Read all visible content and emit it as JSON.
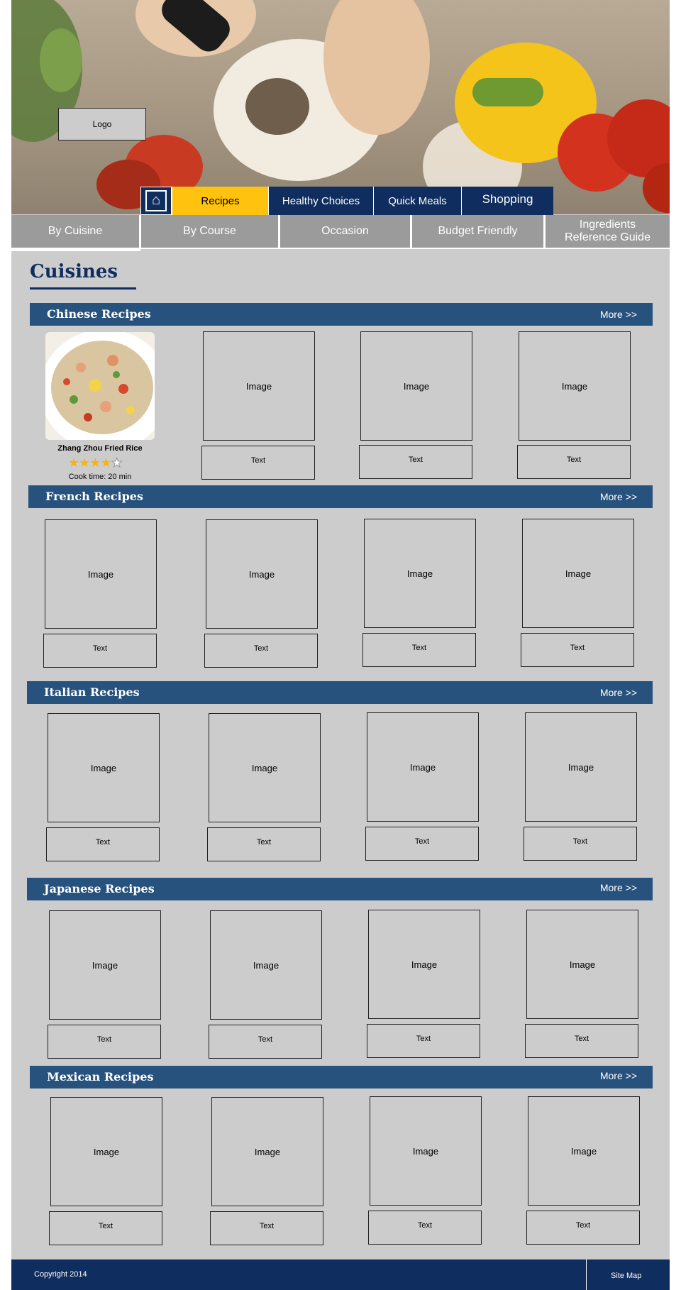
{
  "logo": {
    "label": "Logo"
  },
  "main_nav": {
    "home_icon": "home-icon",
    "items": [
      {
        "label": "Recipes",
        "active": true
      },
      {
        "label": "Healthy Choices",
        "active": false
      },
      {
        "label": "Quick Meals",
        "active": false
      },
      {
        "label": "Shopping",
        "active": false
      }
    ]
  },
  "sub_nav": {
    "tabs": [
      {
        "label": "By Cuisine",
        "active": true
      },
      {
        "label": "By Course"
      },
      {
        "label": "Occasion"
      },
      {
        "label": "Budget Friendly"
      },
      {
        "label": "Ingredients Reference Guide"
      }
    ]
  },
  "page": {
    "title": "Cuisines"
  },
  "sections": [
    {
      "title": "Chinese Recipes",
      "more": "More >>"
    },
    {
      "title": "French Recipes",
      "more": "More >>"
    },
    {
      "title": "Italian Recipes",
      "more": "More >>"
    },
    {
      "title": "Japanese Recipes",
      "more": "More >>"
    },
    {
      "title": "Mexican Recipes",
      "more": "More >>"
    }
  ],
  "featured": {
    "name": "Zhang Zhou Fried Rice",
    "rating": 4,
    "max_rating": 5,
    "cook_time": "Cook time: 20 min"
  },
  "placeholder": {
    "image": "Image",
    "text": "Text"
  },
  "footer": {
    "copyright": "Copyright 2014",
    "sitemap": "Site Map"
  },
  "colors": {
    "nav_blue": "#0f2d5e",
    "section_blue": "#27527d",
    "active_yellow": "#ffc20e",
    "tab_gray": "#9b9b9b"
  }
}
